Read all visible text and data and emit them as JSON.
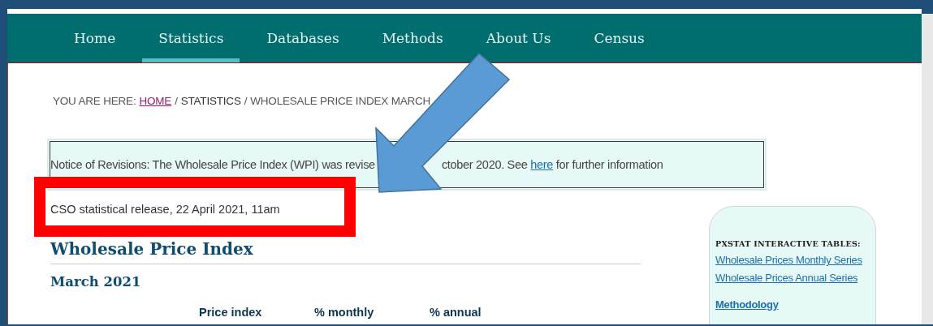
{
  "nav": [
    {
      "label": "Home",
      "selected": false
    },
    {
      "label": "Statistics",
      "selected": true
    },
    {
      "label": "Databases",
      "selected": false
    },
    {
      "label": "Methods",
      "selected": false
    },
    {
      "label": "About Us",
      "selected": false
    },
    {
      "label": "Census",
      "selected": false
    }
  ],
  "breadcrumb": [
    {
      "kind": "prefix",
      "label": "YOU ARE HERE:"
    },
    {
      "kind": "link",
      "label": "HOME"
    },
    {
      "kind": "sep",
      "label": "/"
    },
    {
      "kind": "current",
      "label": "STATISTICS"
    },
    {
      "kind": "sep",
      "label": "/"
    },
    {
      "kind": "text",
      "label": "WHOLESALE PRICE INDEX MARCH"
    }
  ],
  "notice": {
    "before": "Notice of Revisions: The Wholesale Price Index (WPI) was revise",
    "after": "ctober 2020. See",
    "link": "here",
    "end": "for further information"
  },
  "release": "CSO statistical release, 22 April 2021, 11am",
  "title": "Wholesale Price Index",
  "subtitle": "March 2021",
  "table": {
    "columns": [
      "Price index",
      "% monthly",
      "% annual"
    ]
  },
  "sidebar": {
    "heading": "PXSTAT INTERACTIVE TABLES:",
    "links": [
      {
        "label": "Wholesale Prices Monthly Series",
        "kind": "link"
      },
      {
        "label": "Wholesale Prices Annual Series",
        "kind": "link"
      },
      {
        "label": "Methodology",
        "kind": "section"
      }
    ]
  },
  "annotations": [
    {
      "kind": "frame",
      "color": "#ff0000"
    },
    {
      "kind": "arrow",
      "color": "#5b9bd5"
    }
  ]
}
